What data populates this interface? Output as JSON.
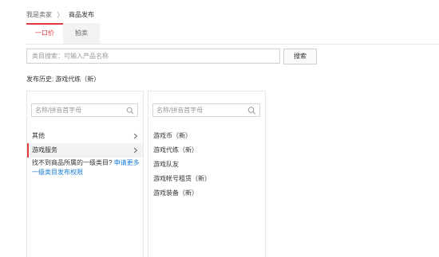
{
  "breadcrumb": {
    "home": "我是卖家",
    "separator": "〉",
    "current": "商品发布"
  },
  "tabs": [
    {
      "label": "一口价"
    },
    {
      "label": "拍卖"
    }
  ],
  "search": {
    "placeholder": "类目搜索：可输入产品名称",
    "value": "",
    "button_label": "搜索"
  },
  "history": {
    "label": "发布历史:",
    "item": "游戏代练（新）"
  },
  "level1": {
    "search_placeholder": "名称/拼音首字母",
    "items": [
      {
        "label": "其他"
      },
      {
        "label": "游戏服务"
      }
    ],
    "notfound_text": "找不到商品所属的一级类目?",
    "notfound_link": "申请更多一级类目发布权限"
  },
  "level2": {
    "search_placeholder": "名称/拼音首字母",
    "items": [
      {
        "label": "游戏币（新）"
      },
      {
        "label": "游戏代练（新）"
      },
      {
        "label": "游戏队友"
      },
      {
        "label": "游戏帐号租赁（新）"
      },
      {
        "label": "游戏装备（新）"
      }
    ]
  },
  "colors": {
    "accent": "#e4393c",
    "link": "#1a7ad9"
  },
  "icons": {
    "search": "search-icon",
    "chevron": "chevron-right-icon",
    "separator": "chevron-right-icon"
  }
}
